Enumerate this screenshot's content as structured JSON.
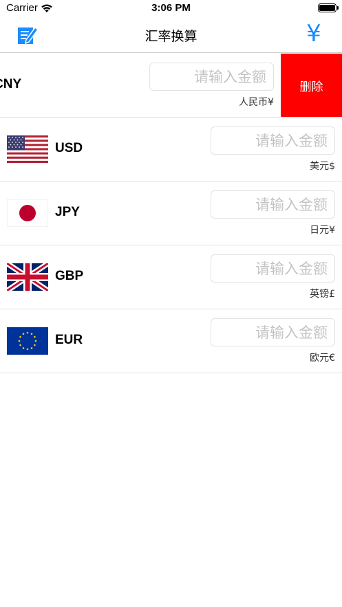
{
  "status_bar": {
    "carrier": "Carrier",
    "time": "3:06 PM"
  },
  "nav": {
    "title": "汇率换算",
    "right_icon": "¥"
  },
  "currencies": [
    {
      "code": "CNY",
      "placeholder": "请输入金额",
      "value": "",
      "unit": "人民币¥",
      "flag": "china-flag",
      "swiped": true
    },
    {
      "code": "USD",
      "placeholder": "请输入金额",
      "value": "",
      "unit": "美元$",
      "flag": "us-flag"
    },
    {
      "code": "JPY",
      "placeholder": "请输入金额",
      "value": "",
      "unit": "日元¥",
      "flag": "japan-flag"
    },
    {
      "code": "GBP",
      "placeholder": "请输入金额",
      "value": "",
      "unit": "英镑£",
      "flag": "uk-flag"
    },
    {
      "code": "EUR",
      "placeholder": "请输入金额",
      "value": "",
      "unit": "欧元€",
      "flag": "eu-flag"
    }
  ],
  "delete_label": "删除",
  "colors": {
    "accent": "#1a8cff",
    "delete": "#ff0000"
  }
}
